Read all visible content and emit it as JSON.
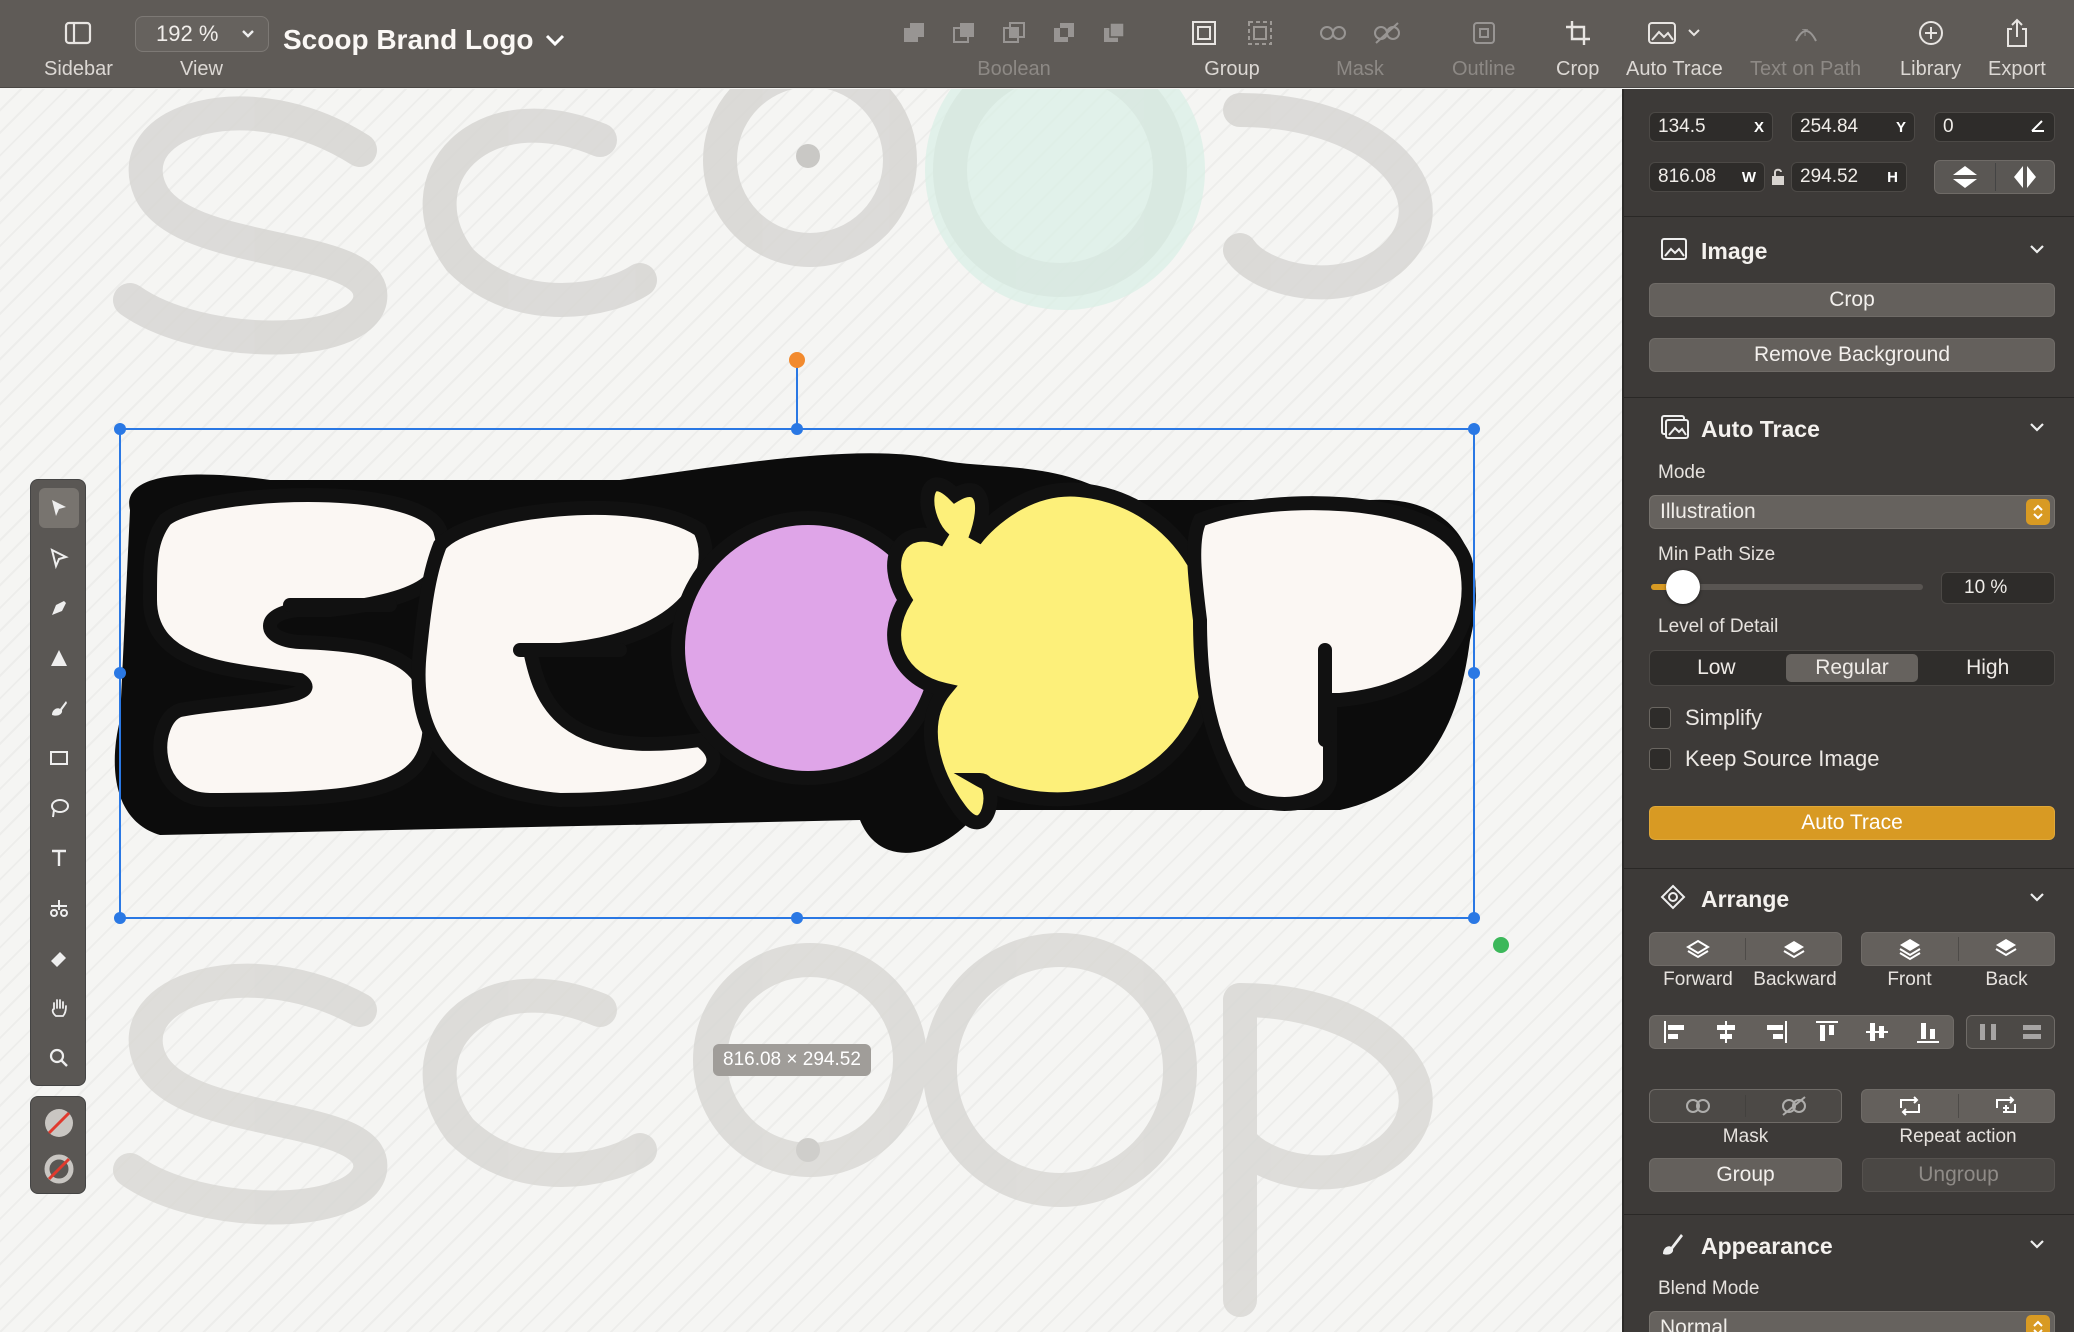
{
  "toolbar": {
    "sidebar_label": "Sidebar",
    "zoom_value": "192 %",
    "view_label": "View",
    "document_title": "Scoop Brand Logo",
    "boolean_label": "Boolean",
    "group_label": "Group",
    "mask_label": "Mask",
    "outline_label": "Outline",
    "crop_label": "Crop",
    "auto_trace_label": "Auto Trace",
    "text_on_path_label": "Text on Path",
    "library_label": "Library",
    "export_label": "Export"
  },
  "canvas": {
    "artwork_text": "SCOOP",
    "selection_size": "816.08 × 294.52",
    "colors": {
      "cream": "#fbf7f3",
      "purple": "#dfa5e8",
      "yellow": "#fdf07a",
      "selection": "#2a78e4",
      "rotate_handle": "#f28a2e",
      "pivot_handle": "#3cb85a"
    }
  },
  "tools": [
    {
      "name": "select-tool",
      "icon": "arrow-icon"
    },
    {
      "name": "direct-select-tool",
      "icon": "subselect-arrow-icon"
    },
    {
      "name": "pen-tool",
      "icon": "pen-icon"
    },
    {
      "name": "pencil-tool",
      "icon": "pencil-icon"
    },
    {
      "name": "brush-tool",
      "icon": "brush-icon"
    },
    {
      "name": "rectangle-tool",
      "icon": "rectangle-icon"
    },
    {
      "name": "lasso-tool",
      "icon": "lasso-icon"
    },
    {
      "name": "text-tool",
      "icon": "text-icon"
    },
    {
      "name": "scissors-tool",
      "icon": "scissors-icon"
    },
    {
      "name": "eraser-tool",
      "icon": "eraser-icon"
    },
    {
      "name": "hand-tool",
      "icon": "hand-icon"
    },
    {
      "name": "zoom-tool",
      "icon": "magnifier-icon"
    }
  ],
  "inspector": {
    "geometry": {
      "x_value": "134.5",
      "x_unit": "X",
      "y_value": "254.84",
      "y_unit": "Y",
      "angle_value": "0",
      "w_value": "816.08",
      "w_unit": "W",
      "h_value": "294.52",
      "h_unit": "H"
    },
    "image_section": {
      "title": "Image",
      "crop_label": "Crop",
      "remove_bg_label": "Remove Background"
    },
    "auto_trace_section": {
      "title": "Auto Trace",
      "mode_label": "Mode",
      "mode_value": "Illustration",
      "min_path_label": "Min Path Size",
      "min_path_value": "10 %",
      "min_path_fraction": 0.1,
      "detail_label": "Level of Detail",
      "detail_options": [
        "Low",
        "Regular",
        "High"
      ],
      "detail_selected": "Regular",
      "simplify_label": "Simplify",
      "keep_source_label": "Keep Source Image",
      "auto_trace_button": "Auto Trace",
      "accent_color": "#d89a23"
    },
    "arrange_section": {
      "title": "Arrange",
      "forward_label": "Forward",
      "backward_label": "Backward",
      "front_label": "Front",
      "back_label": "Back",
      "mask_label": "Mask",
      "repeat_label": "Repeat action",
      "group_label": "Group",
      "ungroup_label": "Ungroup"
    },
    "appearance_section": {
      "title": "Appearance",
      "blend_mode_label": "Blend Mode",
      "blend_mode_value": "Normal"
    }
  }
}
